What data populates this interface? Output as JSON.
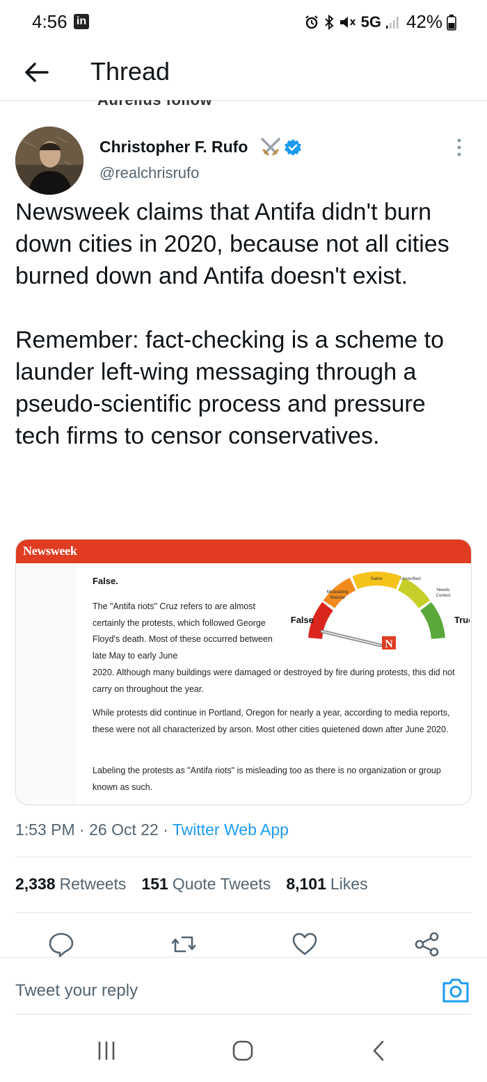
{
  "status_bar": {
    "time": "4:56",
    "app_badge": "in",
    "network": "5G",
    "battery": "42%"
  },
  "header": {
    "title": "Thread"
  },
  "previous_snippet": "Aurelius follow",
  "tweet": {
    "author_name": "Christopher F. Rufo",
    "author_handle": "@realchrisrufo",
    "paragraphs": [
      "Newsweek claims that Antifa didn't burn down cities in 2020, because not all cities burned down and Antifa doesn't exist.",
      "Remember: fact-checking is a scheme to launder left-wing messaging through a pseudo-scientific process and pressure tech firms to censor conservatives."
    ],
    "timestamp": "1:53 PM · 26 Oct 22 · ",
    "source": "Twitter Web App"
  },
  "embed": {
    "brand": "Newsweek",
    "verdict": "False.",
    "para1a": "The \"Antifa riots\" Cruz refers to are almost certainly the protests, which followed George Floyd's death. Most of these occurred between late May to early June",
    "para1b": "2020. Although many buildings were damaged or destroyed by fire during protests, this did not carry on throughout the year.",
    "para2": "While protests did continue in Portland, Oregon for nearly a year, according to media reports, these were not all characterized by arson. Most other cities quietened down after June 2020.",
    "para3": "Labeling the protests as \"Antifa riots\" is misleading too as there is no organization or group known as such.",
    "gauge": {
      "left_label": "False",
      "right_label": "True",
      "misleading": "Misleading",
      "material": "Material",
      "satire": "Satire",
      "unverified": "Unverified",
      "needs": "Needs",
      "context": "Context",
      "badge": "N"
    }
  },
  "stats": {
    "retweets_count": "2,338",
    "retweets_label": "Retweets",
    "quotes_count": "151",
    "quotes_label": "Quote Tweets",
    "likes_count": "8,101",
    "likes_label": "Likes"
  },
  "reply": {
    "placeholder": "Tweet your reply"
  },
  "colors": {
    "accent": "#1d9bf0",
    "newsweek_red": "#e03c22",
    "text_secondary": "#536471"
  }
}
